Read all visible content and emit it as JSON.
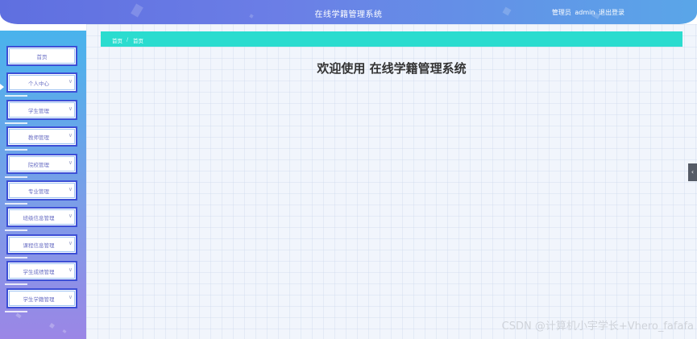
{
  "header": {
    "title": "在线学籍管理系统",
    "role": "管理员",
    "username": "admin",
    "logout": "退出登录"
  },
  "sidebar": {
    "items": [
      {
        "label": "首页",
        "has_chevron": false
      },
      {
        "label": "个人中心",
        "has_chevron": true
      },
      {
        "label": "学生管理",
        "has_chevron": true
      },
      {
        "label": "教师管理",
        "has_chevron": true
      },
      {
        "label": "院校管理",
        "has_chevron": true
      },
      {
        "label": "专业管理",
        "has_chevron": true
      },
      {
        "label": "班级信息管理",
        "has_chevron": true
      },
      {
        "label": "课程信息管理",
        "has_chevron": true
      },
      {
        "label": "学生成绩管理",
        "has_chevron": true
      },
      {
        "label": "学生学籍管理",
        "has_chevron": true
      }
    ]
  },
  "breadcrumb": {
    "root": "首页",
    "separator": "/",
    "current": "首页"
  },
  "main": {
    "welcome": "欢迎使用 在线学籍管理系统"
  },
  "watermark": "CSDN @计算机小宇学长+Vhero_fafafa",
  "colors": {
    "header": "#6b7ee6",
    "breadcrumb_bg": "#2bdccf",
    "menu_border": "#3c4fd6",
    "sidebar_top": "#49b3ec",
    "sidebar_bottom": "#9b86e6"
  }
}
